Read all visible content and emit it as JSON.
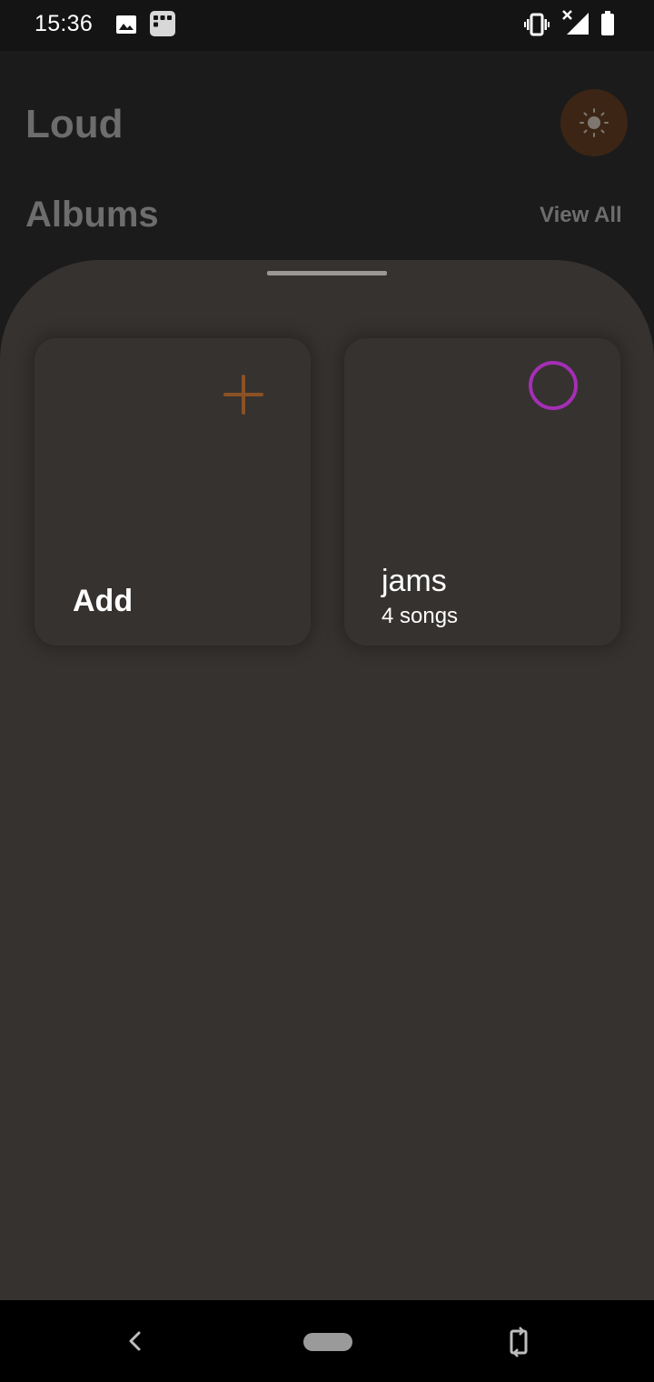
{
  "status_bar": {
    "time": "15:36",
    "icons": [
      "image-icon",
      "app-notification-icon",
      "vibrate-icon",
      "signal-no-data-icon",
      "battery-icon"
    ]
  },
  "header": {
    "app_title": "Loud",
    "theme_toggle_icon": "brightness-icon"
  },
  "albums": {
    "title": "Albums",
    "view_all_label": "View All"
  },
  "sheet": {
    "cards": [
      {
        "title": "Add",
        "icon": "plus-icon",
        "icon_color": "#8a5225"
      },
      {
        "title": "jams",
        "subtitle": "4 songs",
        "icon": "circle-icon",
        "icon_color": "#a42fb5"
      }
    ]
  },
  "nav_bar": {
    "icons": [
      "back-icon",
      "home-pill",
      "rotate-icon"
    ]
  },
  "colors": {
    "accent_orange": "#8a5225",
    "playlist_purple": "#a42fb5",
    "sheet_background": "#363230",
    "app_background": "#1b1b1b"
  }
}
